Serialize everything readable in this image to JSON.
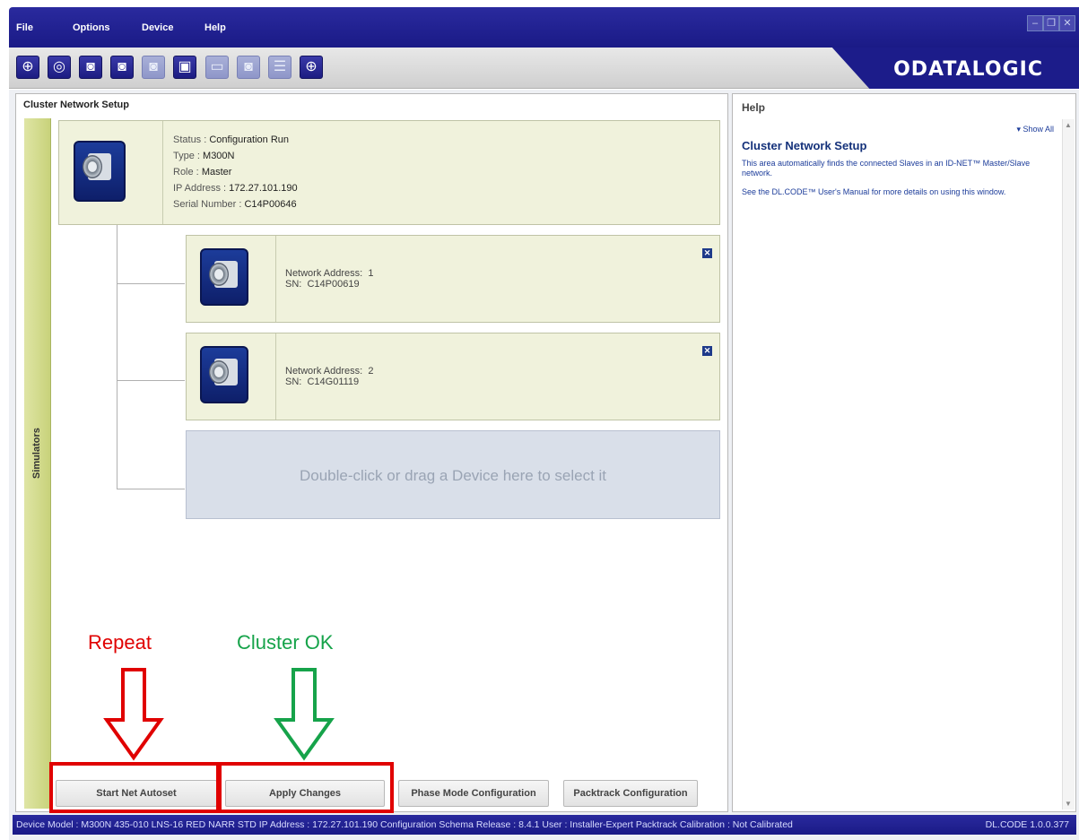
{
  "menu": {
    "items": [
      "File",
      "Options",
      "Device",
      "Help"
    ]
  },
  "window_controls": [
    "minimize-icon",
    "restore-icon",
    "close-icon"
  ],
  "toolbar": {
    "icons": [
      "connect-icon",
      "devices-icon",
      "device-add-icon",
      "device-export-icon",
      "device-settings-icon",
      "device-transfer-icon",
      "window-icon",
      "device-monitor-icon",
      "device-list-icon",
      "crosshair-icon"
    ],
    "brand": "ODATALOGIC"
  },
  "cluster": {
    "title": "Cluster Network Setup",
    "sidebar_label": "Simulators",
    "master": {
      "status_label": "Status :",
      "status_value": "Configuration Run",
      "type_label": "Type :",
      "type_value": "M300N",
      "role_label": "Role :",
      "role_value": "Master",
      "ip_label": "IP Address :",
      "ip_value": "172.27.101.190",
      "serial_label": "Serial Number :",
      "serial_value": "C14P00646"
    },
    "slaves": [
      {
        "address_label": "Network Address:",
        "address_value": "1",
        "sn_label": "SN:",
        "sn_value": "C14P00619"
      },
      {
        "address_label": "Network Address:",
        "address_value": "2",
        "sn_label": "SN:",
        "sn_value": "C14G01119"
      }
    ],
    "dropzone": "Double-click or drag a Device here to select it",
    "buttons": {
      "start": "Start Net Autoset",
      "apply": "Apply Changes",
      "phase": "Phase Mode Configuration",
      "packtrack": "Packtrack Configuration"
    },
    "annotations": {
      "repeat": "Repeat",
      "repeat_color": "#e00000",
      "ok": "Cluster OK",
      "ok_color": "#16a34a"
    }
  },
  "help": {
    "title": "Help",
    "show_all": "▾ Show All",
    "heading": "Cluster Network Setup",
    "para1": "This area automatically finds the connected Slaves in an ID-NET™ Master/Slave network.",
    "para2": "See the DL.CODE™ User's Manual for more details on using this window."
  },
  "statusbar": {
    "text": "Device Model : M300N  435-010  LNS-16 RED NARR STD  IP Address : 172.27.101.190  Configuration Schema Release : 8.4.1  User : Installer-Expert  Packtrack Calibration : Not Calibrated",
    "version": "DL.CODE 1.0.0.377"
  }
}
